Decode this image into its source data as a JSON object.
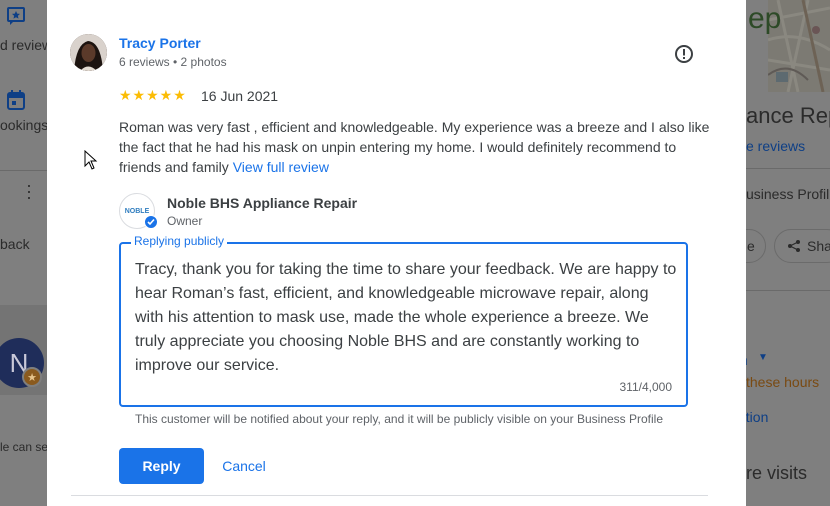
{
  "background": {
    "left": {
      "reviews_label": "d review",
      "bookings_label": "ookings",
      "back_label": "back",
      "avatar_letter": "N",
      "can_see_label": "le can se"
    },
    "right": {
      "ance_title": "ance Rep",
      "reviews_link": "e reviews",
      "business_profile": "usiness Profil",
      "pill_e": "e",
      "share_label": "Sha",
      "m_label": "m",
      "these_hours": "these hours",
      "tion_label": "ation",
      "re_visits": "re visits"
    }
  },
  "review": {
    "reviewer_name": "Tracy Porter",
    "reviewer_meta": "6 reviews • 2 photos",
    "stars": "★★★★★",
    "date": "16 Jun 2021",
    "text": "Roman was very fast , efficient and knowledgeable. My experience was a breeze and I also like the fact that he had his mask on unpin entering my home. I would definitely recommend to friends and family",
    "view_full": "View full review"
  },
  "owner": {
    "avatar_text": "NOBLE",
    "name": "Noble BHS Appliance Repair",
    "role": "Owner"
  },
  "reply": {
    "legend": "Replying publicly",
    "text": "Tracy, thank you for taking the time to share your feedback. We are happy to hear Roman’s fast, efficient, and knowledgeable microwave repair, along with his attention to mask use, made the whole experience a breeze. We truly appreciate you choosing Noble BHS and are constantly working to improve our service.",
    "char_count": "311/4,000",
    "notice": "This customer will be notified about your reply, and it will be publicly visible on your Business Profile",
    "reply_button": "Reply",
    "cancel_button": "Cancel"
  },
  "colors": {
    "accent": "#1a73e8",
    "star": "#fbbc04",
    "overlay": "#7f7f7f"
  }
}
